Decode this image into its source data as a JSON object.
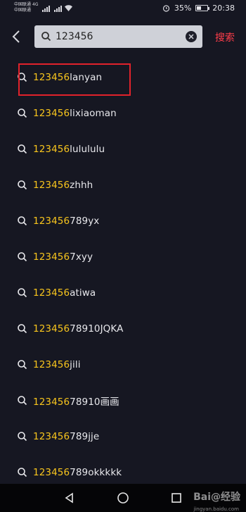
{
  "status_bar": {
    "carrier_1": "中国联通",
    "carrier_2": "中国联通",
    "network_badge": "4G",
    "battery_percent": "35%",
    "time": "20:38",
    "battery_level": 0.35
  },
  "header": {
    "query": "123456",
    "search_label": "搜索"
  },
  "suggestions": [
    {
      "match": "123456",
      "rest": "lanyan"
    },
    {
      "match": "123456",
      "rest": "lixiaoman"
    },
    {
      "match": "123456",
      "rest": "lulululu"
    },
    {
      "match": "123456",
      "rest": "zhhh"
    },
    {
      "match": "123456",
      "rest": "789yx"
    },
    {
      "match": "123456",
      "rest": "7xyy"
    },
    {
      "match": "123456",
      "rest": "atiwa"
    },
    {
      "match": "123456",
      "rest": "78910JQKA"
    },
    {
      "match": "123456",
      "rest": "jili"
    },
    {
      "match": "123456",
      "rest": "78910画画"
    },
    {
      "match": "123456",
      "rest": "789jje"
    },
    {
      "match": "123456",
      "rest": "789okkkkk"
    }
  ],
  "watermark": {
    "brand": "Bai@经验",
    "url": "jingyan.baidu.com"
  },
  "colors": {
    "background": "#161722",
    "match_highlight": "#f8c51d",
    "search_action": "#ff3d4a",
    "annotation_box": "#e1222b"
  },
  "icons": {
    "back": "chevron-left-icon",
    "search": "search-icon",
    "clear": "clear-icon",
    "nav_back": "triangle-back-icon",
    "nav_home": "circle-home-icon",
    "nav_recent": "square-recent-icon"
  }
}
